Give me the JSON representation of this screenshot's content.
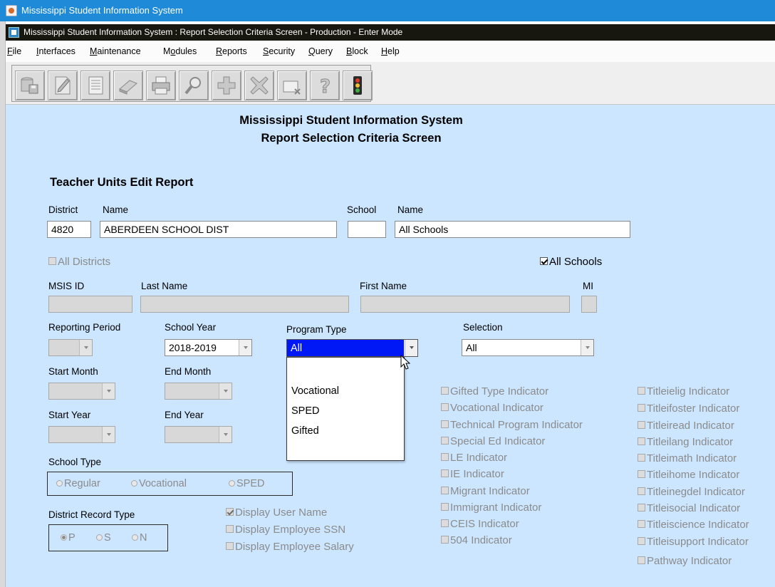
{
  "window": {
    "title": "Mississippi Student Information System",
    "inner_title": "Mississippi Student Information System : Report Selection Criteria Screen  -  Production  -  Enter Mode"
  },
  "menu": [
    {
      "label": "File",
      "mnemonic": "F"
    },
    {
      "label": "Interfaces",
      "mnemonic": "I"
    },
    {
      "label": "Maintenance",
      "mnemonic": "M"
    },
    {
      "label": "Modules",
      "mnemonic": "o"
    },
    {
      "label": "Reports",
      "mnemonic": "R"
    },
    {
      "label": "Security",
      "mnemonic": "S"
    },
    {
      "label": "Query",
      "mnemonic": "Q"
    },
    {
      "label": "Block",
      "mnemonic": "B"
    },
    {
      "label": "Help",
      "mnemonic": "H"
    }
  ],
  "toolbar_icons": [
    "save-icon",
    "edit-icon",
    "list-icon",
    "erase-icon",
    "print-icon",
    "search-icon",
    "add-icon",
    "delete-icon",
    "clear-icon",
    "help-icon",
    "traffic-light-icon"
  ],
  "header": {
    "line1": "Mississippi Student Information System",
    "line2": "Report Selection Criteria Screen"
  },
  "report": {
    "title": "Teacher Units Edit Report",
    "district_label": "District",
    "district_value": "4820",
    "district_name_label": "Name",
    "district_name_value": "ABERDEEN SCHOOL DIST",
    "school_label": "School",
    "school_value": "",
    "school_name_label": "Name",
    "school_name_value": "All Schools",
    "all_districts_label": "All Districts",
    "all_schools_label": "All Schools",
    "msis_id_label": "MSIS ID",
    "last_name_label": "Last Name",
    "first_name_label": "First Name",
    "mi_label": "MI",
    "reporting_period_label": "Reporting Period",
    "school_year_label": "School Year",
    "school_year_value": "2018-2019",
    "program_type_label": "Program Type",
    "program_type_value": "All",
    "program_type_options": [
      "",
      "Vocational",
      "SPED",
      "Gifted"
    ],
    "selection_label": "Selection",
    "selection_value": "All",
    "start_month_label": "Start Month",
    "end_month_label": "End Month",
    "start_year_label": "Start Year",
    "end_year_label": "End Year",
    "school_type_label": "School Type",
    "school_type_options": [
      "Regular",
      "Vocational",
      "SPED"
    ],
    "district_record_type_label": "District Record Type",
    "district_record_type_options": [
      "P",
      "S",
      "N"
    ],
    "display_options": [
      "Display User Name",
      "Display Employee SSN",
      "Display Employee Salary"
    ],
    "indicators_col1": [
      "Gifted Type Indicator",
      "Vocational Indicator",
      "Technical Program Indicator",
      "Special Ed Indicator",
      "LE Indicator",
      "IE Indicator",
      "Migrant Indicator",
      "Immigrant Indicator",
      "CEIS Indicator",
      "504 Indicator"
    ],
    "indicators_col2": [
      "Titleielig Indicator",
      "Titleifoster Indicator",
      "Titleiread Indicator",
      "Titleilang Indicator",
      "Titleimath Indicator",
      "Titleihome Indicator",
      "Titleinegdel Indicator",
      "Titleisocial Indicator",
      "Titleiscience Indicator",
      "Titleisupport Indicator",
      "Pathway Indicator"
    ]
  }
}
